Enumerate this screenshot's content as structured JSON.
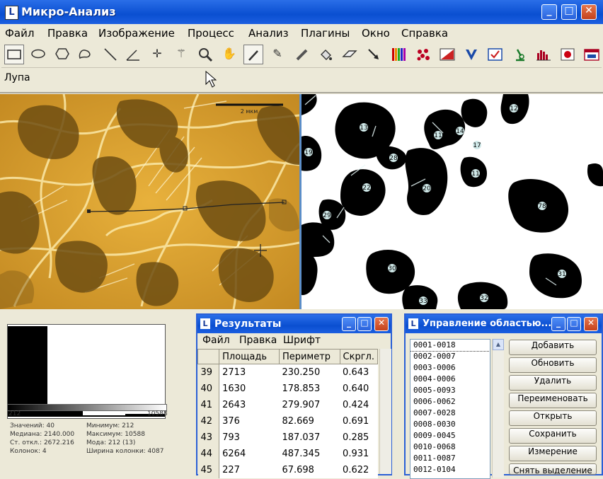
{
  "app": {
    "title": "Микро-Анализ",
    "icon_letter": "L"
  },
  "window_controls": {
    "minimize": "_",
    "maximize": "□",
    "close": "✕"
  },
  "menu": [
    "Файл",
    "Правка",
    "Изображение",
    "Процесс",
    "Анализ",
    "Плагины",
    "Окно",
    "Справка"
  ],
  "toolbar": {
    "tools": [
      "rectangle-tool",
      "oval-tool",
      "polygon-tool",
      "freehand-tool",
      "line-tool",
      "angle-tool",
      "point-tool",
      "wand-tool",
      "magnifier-tool",
      "hand-tool",
      "dropper-tool",
      "pencil-tool",
      "brush-tool",
      "fill-tool",
      "eraser-tool",
      "arrow-tool",
      "lut-icon",
      "particles-icon",
      "threshold-icon",
      "scale-icon",
      "check-icon",
      "microscope-icon",
      "histogram-icon",
      "record-icon",
      "window-icon"
    ],
    "selected": "magnifier-tool"
  },
  "status_text": "Лупа",
  "micro_image": {
    "scale_bar_label": "2 мкм"
  },
  "binary_particles": [
    "13",
    "11",
    "14",
    "12",
    "17",
    "19",
    "28",
    "11",
    "78",
    "22",
    "20",
    "29",
    "30",
    "31",
    "32",
    "33"
  ],
  "histogram": {
    "axis_min": "212",
    "axis_max": "10588",
    "stats": [
      "Значений: 40",
      "Минимум: 212",
      "Медиана: 2140.000",
      "Максимум: 10588",
      "Ст. откл.: 2672.216",
      "Мода: 212 (13)",
      "Колонок: 4",
      "Ширина колонки: 4087"
    ]
  },
  "results": {
    "title": "Результаты",
    "menu": [
      "Файл",
      "Правка",
      "Шрифт"
    ],
    "columns": [
      "Площадь",
      "Периметр",
      "Скргл."
    ],
    "rows": [
      [
        "39",
        "2713",
        "230.250",
        "0.643"
      ],
      [
        "40",
        "1630",
        "178.853",
        "0.640"
      ],
      [
        "41",
        "2643",
        "279.907",
        "0.424"
      ],
      [
        "42",
        "376",
        "82.669",
        "0.691"
      ],
      [
        "43",
        "793",
        "187.037",
        "0.285"
      ],
      [
        "44",
        "6264",
        "487.345",
        "0.931"
      ],
      [
        "45",
        "227",
        "67.698",
        "0.622"
      ]
    ]
  },
  "region_manager": {
    "title": "Управление областью...",
    "items": [
      "0001-0018",
      "0002-0007",
      "0003-0006",
      "0004-0006",
      "0005-0093",
      "0006-0062",
      "0007-0028",
      "0008-0030",
      "0009-0045",
      "0010-0068",
      "0011-0087",
      "0012-0104"
    ],
    "buttons": [
      "Добавить",
      "Обновить",
      "Удалить",
      "Переименовать",
      "Открыть",
      "Сохранить",
      "Измерение",
      "Снять выделение"
    ]
  }
}
